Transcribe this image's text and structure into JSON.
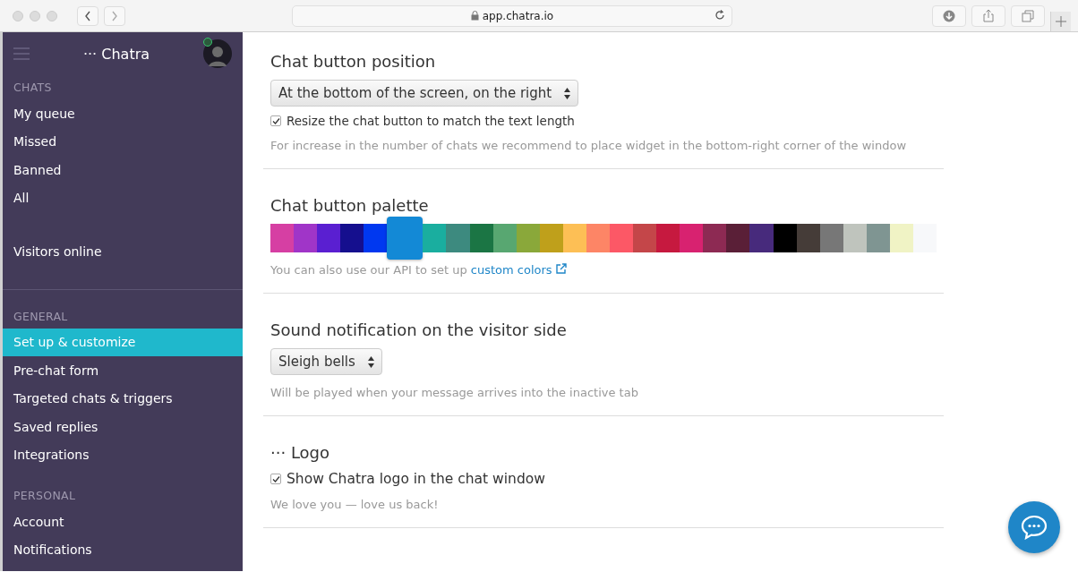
{
  "browser": {
    "url": "app.chatra.io"
  },
  "sidebar": {
    "brand": "··· Chatra",
    "sections": [
      {
        "heading": "CHATS",
        "items": [
          {
            "label": "My queue",
            "selected": false
          },
          {
            "label": "Missed",
            "selected": false
          },
          {
            "label": "Banned",
            "selected": false
          },
          {
            "label": "All",
            "selected": false
          }
        ]
      },
      {
        "items": [
          {
            "label": "Visitors online",
            "selected": false
          }
        ]
      },
      {
        "heading": "GENERAL",
        "items": [
          {
            "label": "Set up & customize",
            "selected": true
          },
          {
            "label": "Pre-chat form",
            "selected": false
          },
          {
            "label": "Targeted chats & triggers",
            "selected": false
          },
          {
            "label": "Saved replies",
            "selected": false
          },
          {
            "label": "Integrations",
            "selected": false
          }
        ]
      },
      {
        "heading": "PERSONAL",
        "items": [
          {
            "label": "Account",
            "selected": false
          },
          {
            "label": "Notifications",
            "selected": false
          }
        ]
      }
    ]
  },
  "position": {
    "heading": "Chat button position",
    "select": "At the bottom of the screen, on the right",
    "checkbox": {
      "label": "Resize the chat button to match the text length",
      "checked": true
    },
    "hint": "For increase in the number of chats we recommend to place widget in the bottom-right corner of the window"
  },
  "palette": {
    "heading": "Chat button palette",
    "swatches": [
      {
        "color": "#d63fa3",
        "selected": false
      },
      {
        "color": "#a035c8",
        "selected": false
      },
      {
        "color": "#5a1fd1",
        "selected": false
      },
      {
        "color": "#150f8e",
        "selected": false
      },
      {
        "color": "#0038f0",
        "selected": false
      },
      {
        "color": "#1389d6",
        "selected": true
      },
      {
        "color": "#1aae9f",
        "selected": false
      },
      {
        "color": "#3d8a7f",
        "selected": false
      },
      {
        "color": "#1b7544",
        "selected": false
      },
      {
        "color": "#58a771",
        "selected": false
      },
      {
        "color": "#8aa83a",
        "selected": false
      },
      {
        "color": "#bfa01b",
        "selected": false
      },
      {
        "color": "#fdbf55",
        "selected": false
      },
      {
        "color": "#fd8566",
        "selected": false
      },
      {
        "color": "#fc5866",
        "selected": false
      },
      {
        "color": "#c44649",
        "selected": false
      },
      {
        "color": "#c6193f",
        "selected": false
      },
      {
        "color": "#d82270",
        "selected": false
      },
      {
        "color": "#8d2a53",
        "selected": false
      },
      {
        "color": "#5a1f37",
        "selected": false
      },
      {
        "color": "#472a7c",
        "selected": false
      },
      {
        "color": "#000000",
        "selected": false
      },
      {
        "color": "#453c38",
        "selected": false
      },
      {
        "color": "#777777",
        "selected": false
      },
      {
        "color": "#bfc4bd",
        "selected": false
      },
      {
        "color": "#7f9592",
        "selected": false
      },
      {
        "color": "#f0f3c5",
        "selected": false
      },
      {
        "color": "#f7f8fa",
        "selected": false
      }
    ],
    "hint": "You can also use our API to set up",
    "link": "custom colors"
  },
  "sound": {
    "heading": "Sound notification on the visitor side",
    "select": "Sleigh bells",
    "hint": "Will be played when your message arrives into the inactive tab"
  },
  "logo": {
    "heading": "··· Logo",
    "checkbox": {
      "label": "Show Chatra logo in the chat window",
      "checked": true
    },
    "hint": "We love you — love us back!"
  }
}
